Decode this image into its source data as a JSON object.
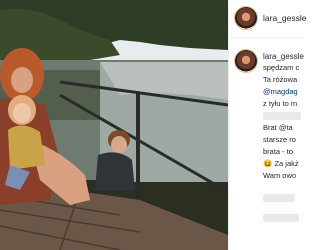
{
  "post": {
    "photo_description": "",
    "header_username": "lara_gessle"
  },
  "caption": {
    "username": "lara_gessle",
    "lines": [
      "spędzam c",
      "Ta różowa",
      "@magdag",
      "z tyłu to m",
      "Brat @ta",
      "starsze ro",
      "brata - to",
      "Za jakż",
      "Wam owo"
    ]
  },
  "colors": {
    "link": "#00376b",
    "text": "#262626",
    "border": "#efefef"
  },
  "icons": {
    "avatar": "avatar",
    "emoji": "face-emoji"
  }
}
